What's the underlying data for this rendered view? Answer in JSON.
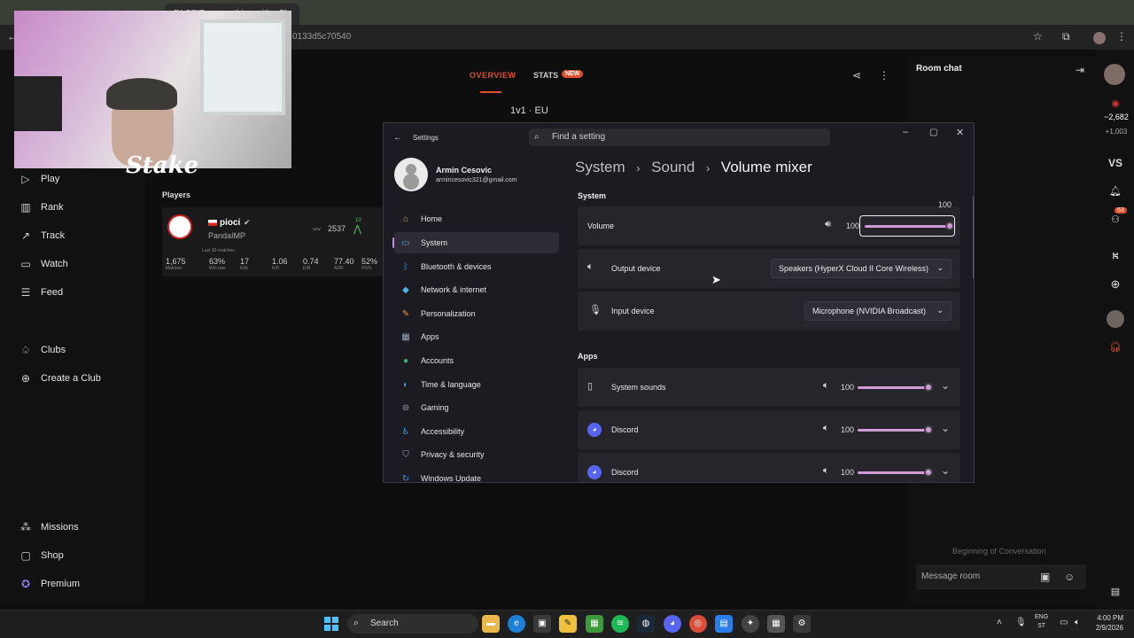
{
  "browser": {
    "tab_title": "FACEIT · something with - Fla",
    "url": "0133d5c70540"
  },
  "webcam": {
    "watermark": "Stake"
  },
  "leftnav": {
    "items": [
      {
        "label": "Play",
        "icon": "play-icon"
      },
      {
        "label": "Rank",
        "icon": "rank-icon"
      },
      {
        "label": "Track",
        "icon": "track-icon"
      },
      {
        "label": "Watch",
        "icon": "watch-icon"
      },
      {
        "label": "Feed",
        "icon": "feed-icon"
      },
      {
        "label": "Clubs",
        "icon": "clubs-icon"
      },
      {
        "label": "Create a Club",
        "icon": "plus-circle-icon"
      },
      {
        "label": "Missions",
        "icon": "missions-icon"
      },
      {
        "label": "Shop",
        "icon": "shop-icon"
      },
      {
        "label": "Premium",
        "icon": "premium-icon"
      }
    ]
  },
  "match": {
    "tabs": {
      "overview": "OVERVIEW",
      "stats": "STATS",
      "new_badge": "NEW"
    },
    "mode": "1v1 · EU",
    "players_title": "Players",
    "player": {
      "name": "pioci",
      "sub": "PandaIMP",
      "elo": "2537",
      "level": "10",
      "last_label": "Last 30 matches",
      "stats": [
        {
          "value": "1,675",
          "label": "Matches"
        },
        {
          "value": "63%",
          "label": "Win rate"
        },
        {
          "value": "17",
          "label": "Kills"
        },
        {
          "value": "1.06",
          "label": "K/D"
        },
        {
          "value": "0.74",
          "label": "K/R"
        },
        {
          "value": "77.40",
          "label": "ADR"
        },
        {
          "value": "52%",
          "label": "HS%"
        }
      ]
    }
  },
  "roomchat": {
    "title": "Room chat",
    "begin": "Beginning of Conversation",
    "placeholder": "Message room"
  },
  "rightrail": {
    "count_1": "~2,682",
    "count_2": "+1,003",
    "vs": "VS",
    "badge_53": "53"
  },
  "settings": {
    "title": "Settings",
    "search_placeholder": "Find a setting",
    "profile": {
      "name": "Armin Cesovic",
      "email": "armincesovic321@gmail.com"
    },
    "sidebar": [
      {
        "label": "Home",
        "icon": "home-icon",
        "color": "#e8a14e"
      },
      {
        "label": "System",
        "icon": "system-icon",
        "color": "#4aa3e6"
      },
      {
        "label": "Bluetooth & devices",
        "icon": "bluetooth-icon",
        "color": "#3a8be3"
      },
      {
        "label": "Network & internet",
        "icon": "wifi-icon",
        "color": "#4fb4e8"
      },
      {
        "label": "Personalization",
        "icon": "brush-icon",
        "color": "#e59552"
      },
      {
        "label": "Apps",
        "icon": "apps-icon",
        "color": "#9aa7b8"
      },
      {
        "label": "Accounts",
        "icon": "accounts-icon",
        "color": "#35b37a"
      },
      {
        "label": "Time & language",
        "icon": "globe-icon",
        "color": "#3b9ee3"
      },
      {
        "label": "Gaming",
        "icon": "gaming-icon",
        "color": "#9aa0a8"
      },
      {
        "label": "Accessibility",
        "icon": "accessibility-icon",
        "color": "#3a9ee8"
      },
      {
        "label": "Privacy & security",
        "icon": "shield-icon",
        "color": "#9aa0a8"
      },
      {
        "label": "Windows Update",
        "icon": "update-icon",
        "color": "#3b8fe3"
      }
    ],
    "breadcrumb": [
      "System",
      "Sound",
      "Volume mixer"
    ],
    "system_section": "System",
    "volume": {
      "label": "Volume",
      "value": "100",
      "tooltip": "100",
      "level": 1.0
    },
    "output": {
      "label": "Output device",
      "value": "Speakers (HyperX Cloud II Core Wireless)"
    },
    "input": {
      "label": "Input device",
      "value": "Microphone (NVIDIA Broadcast)"
    },
    "apps_section": "Apps",
    "apps": [
      {
        "name": "System sounds",
        "value": "100",
        "level": 1.0,
        "icon": "system-sounds-icon"
      },
      {
        "name": "Discord",
        "value": "100",
        "level": 1.0,
        "icon": "discord-icon"
      },
      {
        "name": "Discord",
        "value": "100",
        "level": 1.0,
        "icon": "discord-icon"
      }
    ],
    "accent": "#d09ad9"
  },
  "taskbar": {
    "search": "Search",
    "lang_1": "ENG",
    "lang_2": "ST",
    "time": "4:00 PM",
    "date": "2/9/2026"
  }
}
